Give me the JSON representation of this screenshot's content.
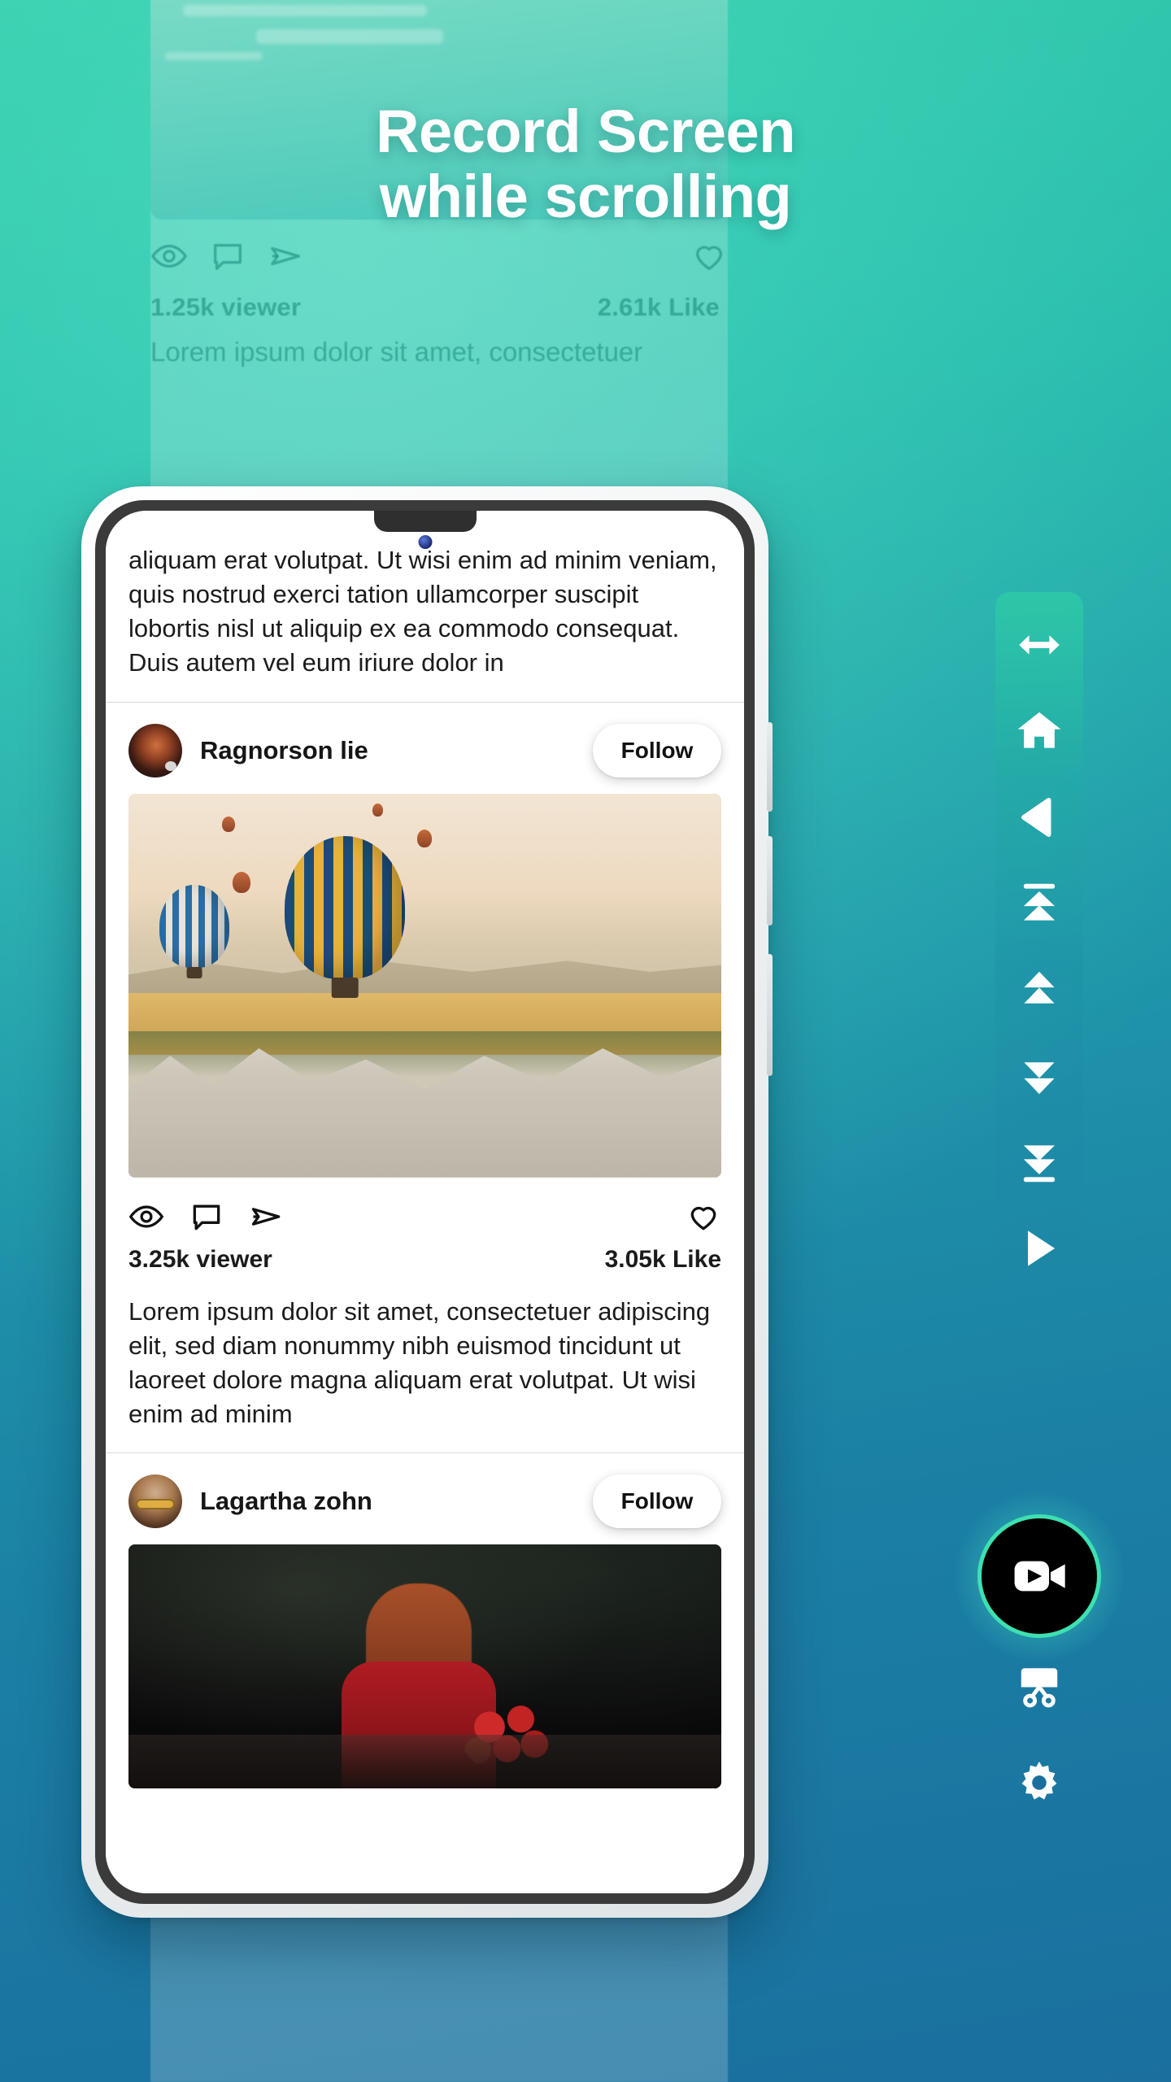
{
  "headline": {
    "line1": "Record Screen",
    "line2": "while scrolling"
  },
  "background_feed": {
    "stats": {
      "viewer": "1.25k viewer",
      "like": "2.61k Like"
    },
    "body": "Lorem ipsum dolor sit amet, consectetuer",
    "icons": [
      "eye-icon",
      "comment-icon",
      "send-icon",
      "heart-icon"
    ]
  },
  "phone": {
    "top_post": {
      "text": "aliquam erat volutpat. Ut wisi enim ad minim veniam, quis nostrud exerci tation ullamcorper suscipit lobortis nisl ut aliquip ex ea commodo consequat. Duis autem vel eum iriure dolor in"
    },
    "posts": [
      {
        "username": "Ragnorson lie",
        "follow_label": "Follow",
        "image": "hot-air-balloon-photo",
        "actions": [
          "eye-icon",
          "comment-icon",
          "send-icon",
          "heart-icon"
        ],
        "viewer": "3.25k viewer",
        "like": "3.05k Like",
        "caption": "Lorem ipsum dolor sit amet, consectetuer adipiscing elit, sed diam nonummy nibh euismod tincidunt ut laoreet dolore magna aliquam erat volutpat. Ut wisi enim ad minim"
      },
      {
        "username": "Lagartha zohn",
        "follow_label": "Follow",
        "image": "woman-with-flowers-photo"
      }
    ]
  },
  "toolbar": {
    "items": [
      {
        "name": "resize-horizontal-icon",
        "label": "Resize"
      },
      {
        "name": "home-icon",
        "label": "Home"
      },
      {
        "name": "back-icon",
        "label": "Back"
      },
      {
        "name": "scroll-to-top-icon",
        "label": "Scroll to top"
      },
      {
        "name": "scroll-up-icon",
        "label": "Scroll up"
      },
      {
        "name": "scroll-down-icon",
        "label": "Scroll down"
      },
      {
        "name": "scroll-to-bottom-icon",
        "label": "Scroll to bottom"
      },
      {
        "name": "play-icon",
        "label": "Play"
      }
    ],
    "record": {
      "name": "video-record-icon",
      "label": "Record"
    },
    "bottom_items": [
      {
        "name": "scissors-icon",
        "label": "Trim"
      },
      {
        "name": "gear-icon",
        "label": "Settings"
      }
    ]
  },
  "colors": {
    "accent_teal": "#2fc9a8",
    "accent_blue": "#1a6f9e",
    "record_ring": "#3fe0b0",
    "headline_text": "#ffffff"
  }
}
